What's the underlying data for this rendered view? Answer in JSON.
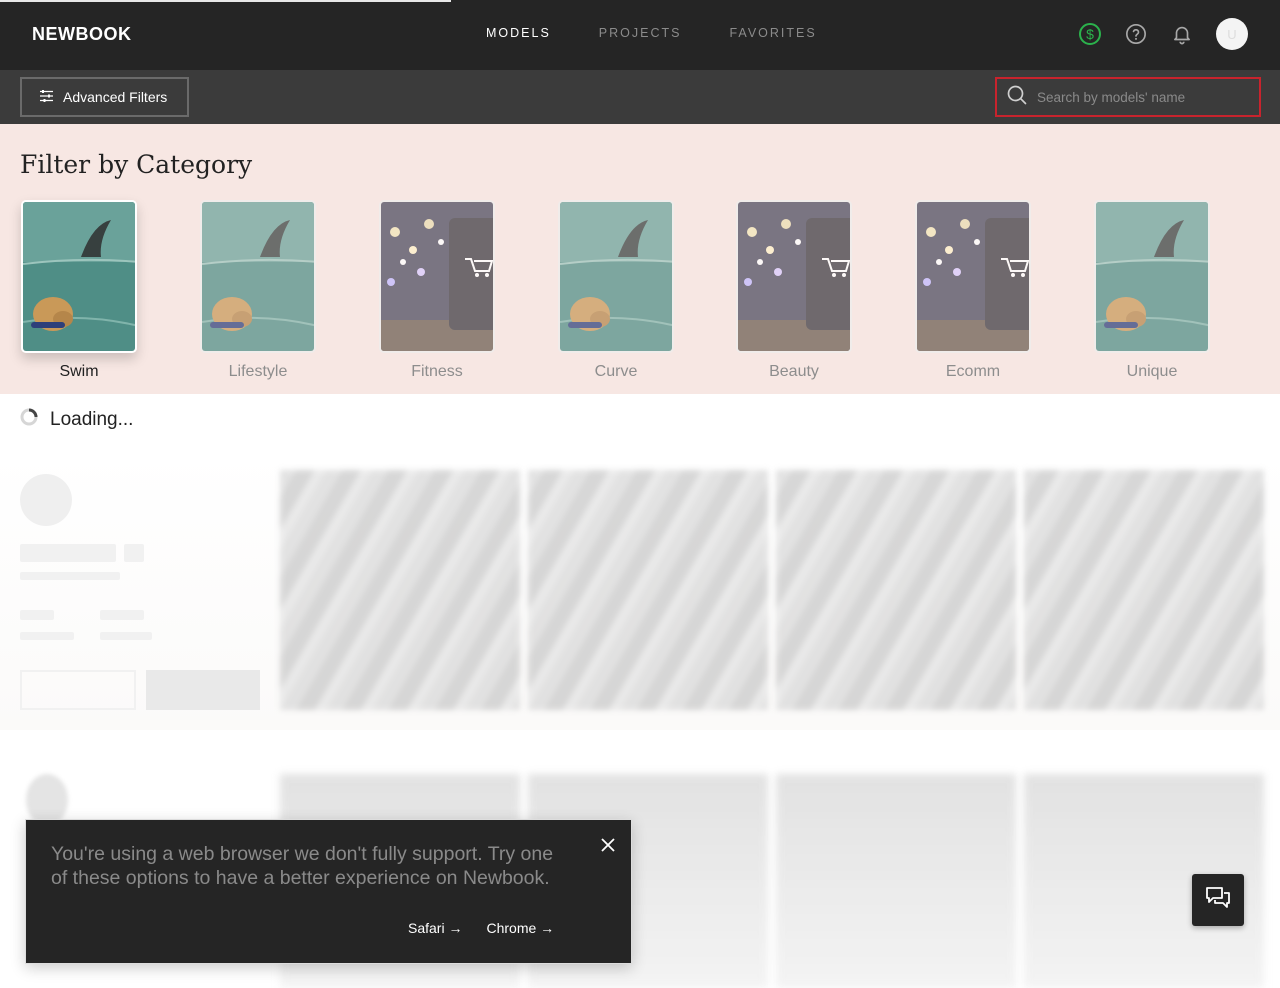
{
  "nav": {
    "logo": "NEWBOOK",
    "links": [
      {
        "label": "MODELS",
        "active": true
      },
      {
        "label": "PROJECTS",
        "active": false
      },
      {
        "label": "FAVORITES",
        "active": false
      }
    ],
    "avatar_initial": "U",
    "icons": [
      "dollar-icon",
      "help-icon",
      "bell-icon"
    ],
    "accent_green": "#2bb24c"
  },
  "filterbar": {
    "advanced_filters_label": "Advanced Filters",
    "search_placeholder": "Search by models' name",
    "search_value": "",
    "search_border_color": "#c8232d"
  },
  "category": {
    "title": "Filter by Category",
    "items": [
      {
        "label": "Swim",
        "image": "dolphin-dog",
        "selected": true
      },
      {
        "label": "Lifestyle",
        "image": "dolphin-dog",
        "selected": false
      },
      {
        "label": "Fitness",
        "image": "shopping-cart",
        "selected": false
      },
      {
        "label": "Curve",
        "image": "dolphin-dog",
        "selected": false
      },
      {
        "label": "Beauty",
        "image": "shopping-cart",
        "selected": false
      },
      {
        "label": "Ecomm",
        "image": "shopping-cart",
        "selected": false
      },
      {
        "label": "Unique",
        "image": "dolphin-dog",
        "selected": false
      }
    ]
  },
  "loading": {
    "label": "Loading..."
  },
  "toast": {
    "message": "You're using a web browser we don't fully support. Try one of these options to have a better experience on Newbook.",
    "links": [
      "Safari →",
      "Chrome →"
    ]
  }
}
